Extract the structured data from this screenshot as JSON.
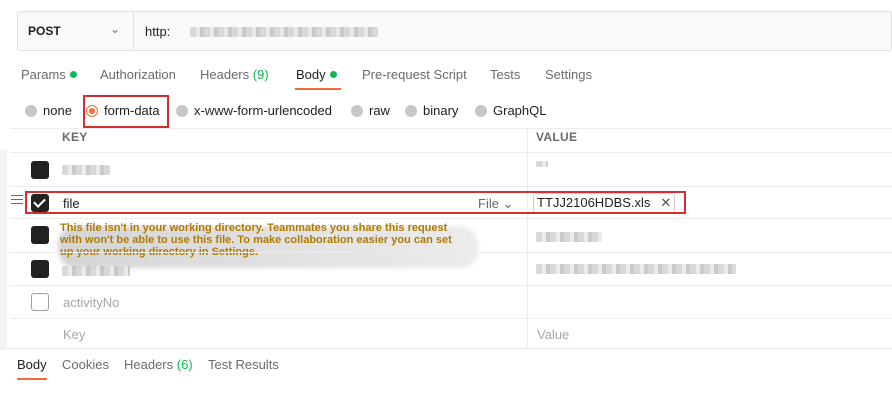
{
  "request": {
    "method": "POST",
    "url_prefix": "http:"
  },
  "request_tabs": [
    {
      "label": "Params",
      "indicator": "dot"
    },
    {
      "label": "Authorization"
    },
    {
      "label": "Headers",
      "count": "(9)"
    },
    {
      "label": "Body",
      "indicator": "dot",
      "active": true
    },
    {
      "label": "Pre-request Script"
    },
    {
      "label": "Tests"
    },
    {
      "label": "Settings"
    }
  ],
  "body_types": [
    "none",
    "form-data",
    "x-www-form-urlencoded",
    "raw",
    "binary",
    "GraphQL"
  ],
  "body_type_selected": "form-data",
  "table": {
    "headers": {
      "key": "KEY",
      "value": "VALUE"
    },
    "rows": [
      {
        "key": "file",
        "type": "File",
        "value": "TTJJ2106HDBS.xls",
        "checked": true
      },
      {
        "key": "activityNo",
        "value": "",
        "checked": false
      }
    ],
    "placeholder_key": "Key",
    "placeholder_value": "Value"
  },
  "warning": {
    "text": "This file isn't in your working directory. Teammates you share this request with won't be able to use this file. To make collaboration easier you can set up your working directory in Settings."
  },
  "response_tabs": [
    {
      "label": "Body",
      "active": true
    },
    {
      "label": "Cookies"
    },
    {
      "label": "Headers",
      "count": "(6)"
    },
    {
      "label": "Test Results"
    }
  ],
  "colors": {
    "accent": "#f26b3a",
    "status_green": "#0cbb52",
    "highlight_red": "#d32f2f"
  }
}
